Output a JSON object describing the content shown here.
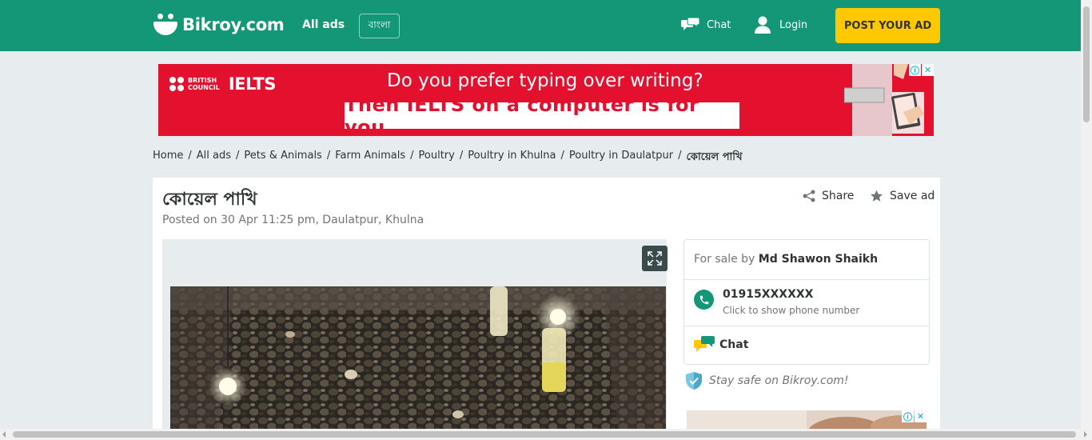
{
  "header": {
    "logo_text": "Bikroy.com",
    "all_ads": "All ads",
    "language": "বাংলা",
    "chat": "Chat",
    "login": "Login",
    "post_ad": "POST YOUR AD"
  },
  "banner": {
    "brand_line1": "BRITISH",
    "brand_line2": "COUNCIL",
    "brand_product": "IELTS",
    "headline": "Do you prefer typing over writing?",
    "subline": "Then IELTS on a computer is for you"
  },
  "breadcrumb": [
    "Home",
    "All ads",
    "Pets & Animals",
    "Farm Animals",
    "Poultry",
    "Poultry in Khulna",
    "Poultry in Daulatpur",
    "কোয়েল পাখি"
  ],
  "listing": {
    "title": "কোয়েল পাখি",
    "posted": "Posted on 30 Apr 11:25 pm, Daulatpur, Khulna",
    "share": "Share",
    "save": "Save ad"
  },
  "seller": {
    "for_sale_by": "For sale by",
    "name": "Md Shawon Shaikh",
    "phone": "01915XXXXXX",
    "phone_hint": "Click to show phone number",
    "chat": "Chat",
    "safety": "Stay safe on Bikroy.com!"
  },
  "colors": {
    "brand_green": "#149777",
    "post_yellow": "#ffc800",
    "ad_red": "#e4112e"
  }
}
